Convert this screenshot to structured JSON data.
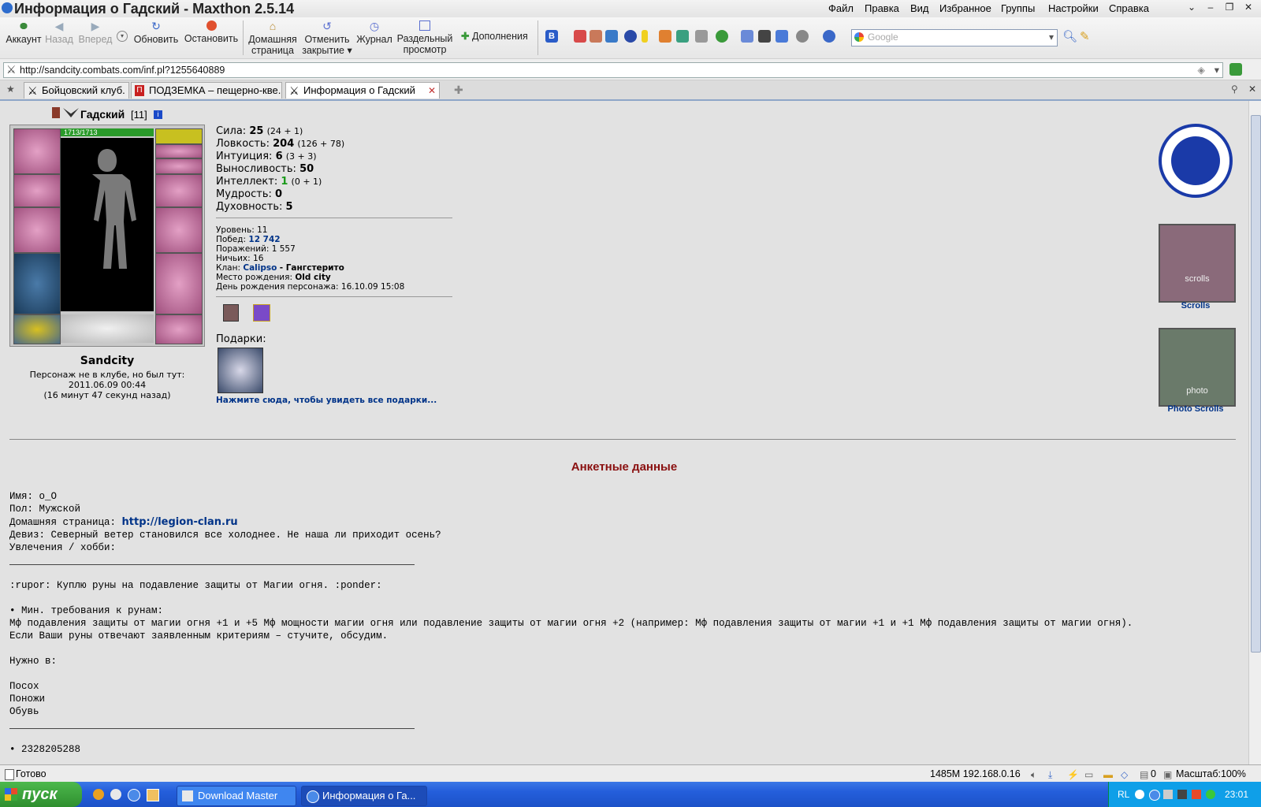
{
  "window": {
    "title": "Информация о Гадский - Maxthon 2.5.14"
  },
  "menu": [
    "Файл",
    "Правка",
    "Вид",
    "Избранное",
    "Группы",
    "Настройки",
    "Справка"
  ],
  "toolbar": {
    "account": "Аккаунт",
    "back": "Назад",
    "forward": "Вперед",
    "refresh": "Обновить",
    "stop": "Остановить",
    "home_l1": "Домашняя",
    "home_l2": "страница",
    "undo_l1": "Отменить",
    "undo_l2": "закрытие",
    "journal": "Журнал",
    "split_l1": "Раздельный",
    "split_l2": "просмотр",
    "addons": "Дополнения",
    "search_placeholder": "Google"
  },
  "address": {
    "url": "http://sandcity.combats.com/inf.pl?1255640889"
  },
  "tabs": [
    {
      "label": "Бойцовский клуб."
    },
    {
      "label": "ПОДЗЕМКА – пещерно-кве..."
    },
    {
      "label": "Информация о Гадский"
    }
  ],
  "character": {
    "name": "Гадский",
    "level_text": "[11]",
    "hp": "1713/1713",
    "city": "Sandcity",
    "status1": "Персонаж не в клубе, но был тут:",
    "status2": "2011.06.09 00:44",
    "status3": "(16 минут 47 секунд назад)"
  },
  "stats": [
    {
      "label": "Сила:",
      "value": "25",
      "extra": "(24 + 1)"
    },
    {
      "label": "Ловкость:",
      "value": "204",
      "extra": "(126 + 78)"
    },
    {
      "label": "Интуиция:",
      "value": "6",
      "extra": "(3 + 3)"
    },
    {
      "label": "Выносливость:",
      "value": "50",
      "extra": ""
    },
    {
      "label": "Интеллект:",
      "value": "1",
      "extra": "(0 + 1)"
    },
    {
      "label": "Мудрость:",
      "value": "0",
      "extra": ""
    },
    {
      "label": "Духовность:",
      "value": "5",
      "extra": ""
    }
  ],
  "info": {
    "level": "Уровень: 11",
    "wins_label": "Побед:",
    "wins": "12 742",
    "losses": "Поражений: 1 557",
    "draws": "Ничьих: 16",
    "clan_label": "Клан:",
    "clan": "Calipso",
    "clan_rank": "- Гангстерито",
    "birthplace_label": "Место рождения:",
    "birthplace": "Old city",
    "birthday": "День рождения персонажа: 16.10.09 15:08"
  },
  "gifts": {
    "title": "Подарки:",
    "link": "Нажмите сюда, чтобы увидеть все подарки..."
  },
  "side": {
    "scrolls": "Scrolls",
    "photo_scrolls": "Photo Scrolls",
    "scroll_word": "scrolls",
    "photo_word": "photo"
  },
  "profile": {
    "heading": "Анкетные данные",
    "name": "Имя: o_O",
    "sex": "Пол: Мужской",
    "homepage_label": "Домашняя страница:",
    "homepage": "http://legion-clan.ru",
    "motto": "Девиз: Северный ветер становился все холоднее. Не наша ли приходит осень?",
    "hobby": "Увлечения / хобби:",
    "l1": ":rupor: Куплю руны на подавление защиты от Магии огня. :ponder:",
    "l2": "• Мин. требования к рунам:",
    "l3": "Мф подавления защиты от магии огня +1 и +5 Мф мощности магии огня или подавление защиты от магии огня +2 (например: Мф подавления защиты от магии +1 и +1 Мф подавления защиты от магии огня).",
    "l4": "Если Ваши руны отвечают заявленным критериям – стучите, обсудим.",
    "l5": "Нужно в:",
    "l6": "Посох",
    "l7": "Поножи",
    "l8": "Обувь",
    "l9": "• 2328205288"
  },
  "status": {
    "ready": "Готово",
    "memory": "1485M 192.168.0.16",
    "count": "0",
    "zoom": "Масштаб:100%"
  },
  "taskbar": {
    "start": "пуск",
    "task1": "Download Master",
    "task2": "Информация о Га...",
    "lang": "RL",
    "time": "23:01"
  }
}
